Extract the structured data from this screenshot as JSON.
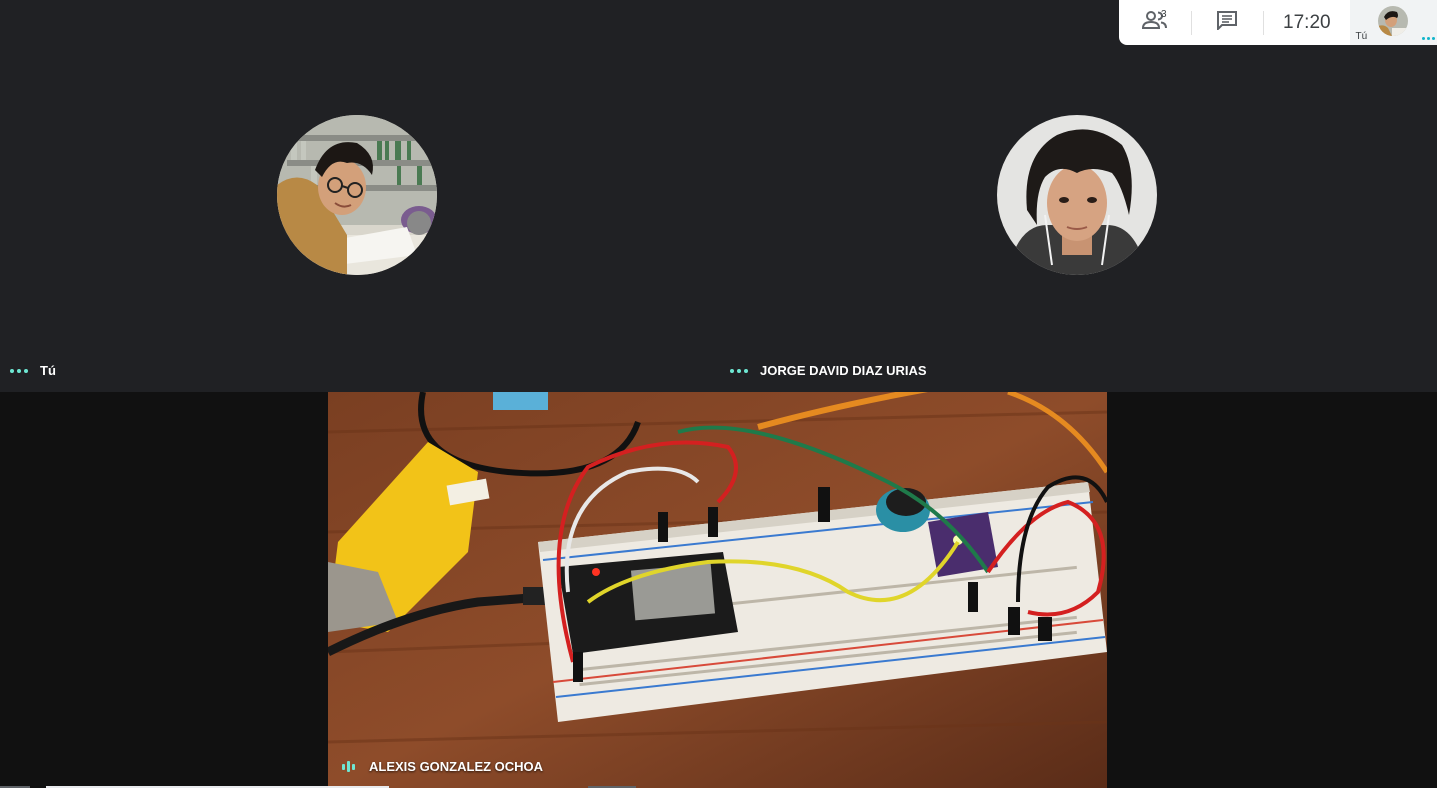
{
  "participants": {
    "left": {
      "name": "Tú",
      "avatar_icon": "user-photo-library"
    },
    "right": {
      "name": "JORGE DAVID DIAZ URIAS",
      "avatar_icon": "user-photo-portrait"
    }
  },
  "presentation": {
    "presenter_name": "ALEXIS GONZALEZ OCHOA",
    "content_icon": "video-breadboard-circuit"
  },
  "topbar": {
    "people_icon": "people-icon",
    "people_count": "3",
    "chat_icon": "chat-icon",
    "time": "17:20",
    "self_label": "Tú"
  },
  "colors": {
    "background": "#202124",
    "accent": "#6ee7d3",
    "topbar_bg": "#ffffff"
  }
}
